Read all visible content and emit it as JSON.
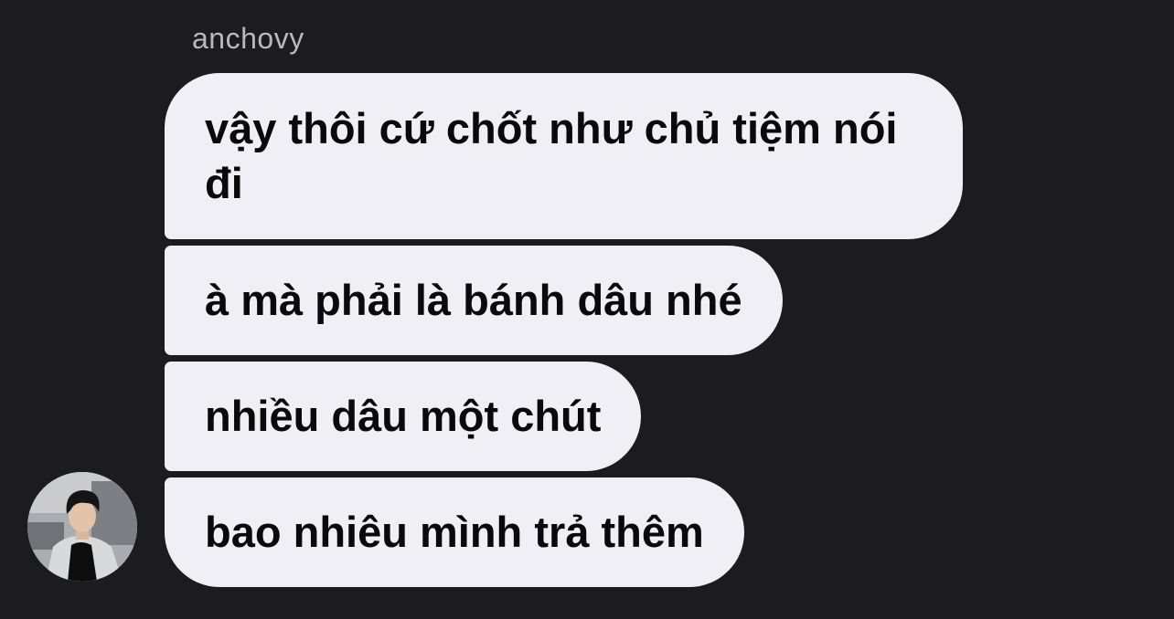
{
  "conversation": {
    "sender_name": "anchovy",
    "avatar_icon": "user-photo-avatar",
    "messages": [
      {
        "text": "vậy thôi cứ chốt như chủ tiệm nói đi"
      },
      {
        "text": "à mà phải là bánh dâu nhé"
      },
      {
        "text": "nhiều dâu một chút"
      },
      {
        "text": "bao nhiêu mình trả thêm"
      }
    ]
  },
  "colors": {
    "background": "#1c1c1e",
    "bubble": "#efeff5",
    "bubble_text": "#0a0a0a",
    "sender_name": "#b8b8bd"
  }
}
